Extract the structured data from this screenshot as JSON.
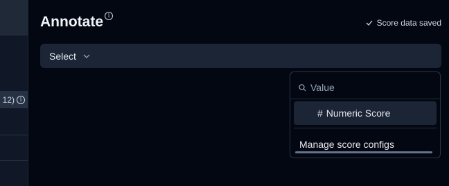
{
  "sidebar": {
    "highlight_text": "12)"
  },
  "header": {
    "title": "Annotate",
    "saved_status": "Score data saved"
  },
  "select": {
    "label": "Select"
  },
  "dropdown": {
    "search_placeholder": "Value",
    "option_prefix": "#",
    "option_label": "Numeric Score",
    "manage_label": "Manage score configs"
  },
  "icons": [
    "info-icon",
    "check-icon",
    "chevron-down-icon",
    "search-icon"
  ]
}
